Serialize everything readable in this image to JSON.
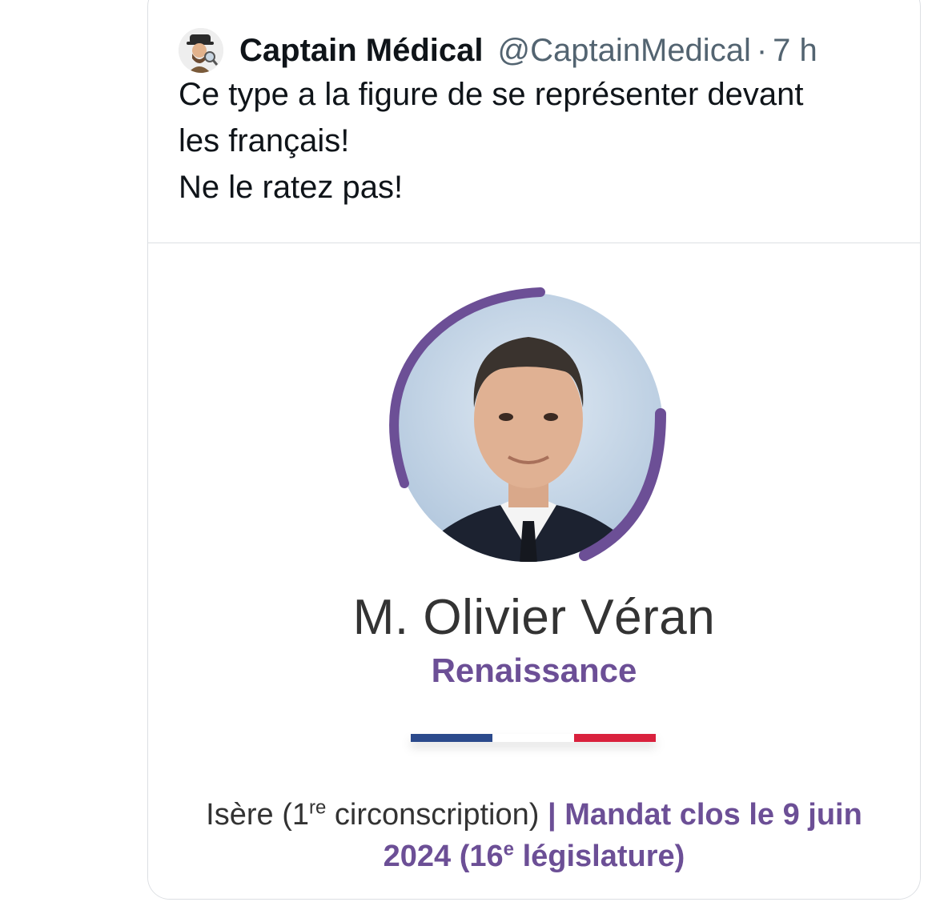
{
  "tweet": {
    "author": {
      "display_name": "Captain Médical",
      "handle": "@CaptainMedical",
      "separator": "·",
      "time": "7 h"
    },
    "text_lines": [
      "Ce type a la figure de se représenter devant",
      "les français!",
      "Ne le ratez pas!"
    ]
  },
  "media_card": {
    "name": "M. Olivier Véran",
    "party": "Renaissance",
    "flag_colors": [
      "#2b4a8c",
      "#ffffff",
      "#d9213d"
    ],
    "accent_color": "#6c4f96",
    "mandate": {
      "dept": "Isère (1",
      "circ_sup": "re",
      "circ_text": " circonscription) ",
      "pipe": "| ",
      "status": "Mandat clos le 9 juin",
      "year": "2024 (16",
      "leg_sup": "e",
      "leg_text": " législature)"
    },
    "photo_icon": "portrait-photo"
  }
}
